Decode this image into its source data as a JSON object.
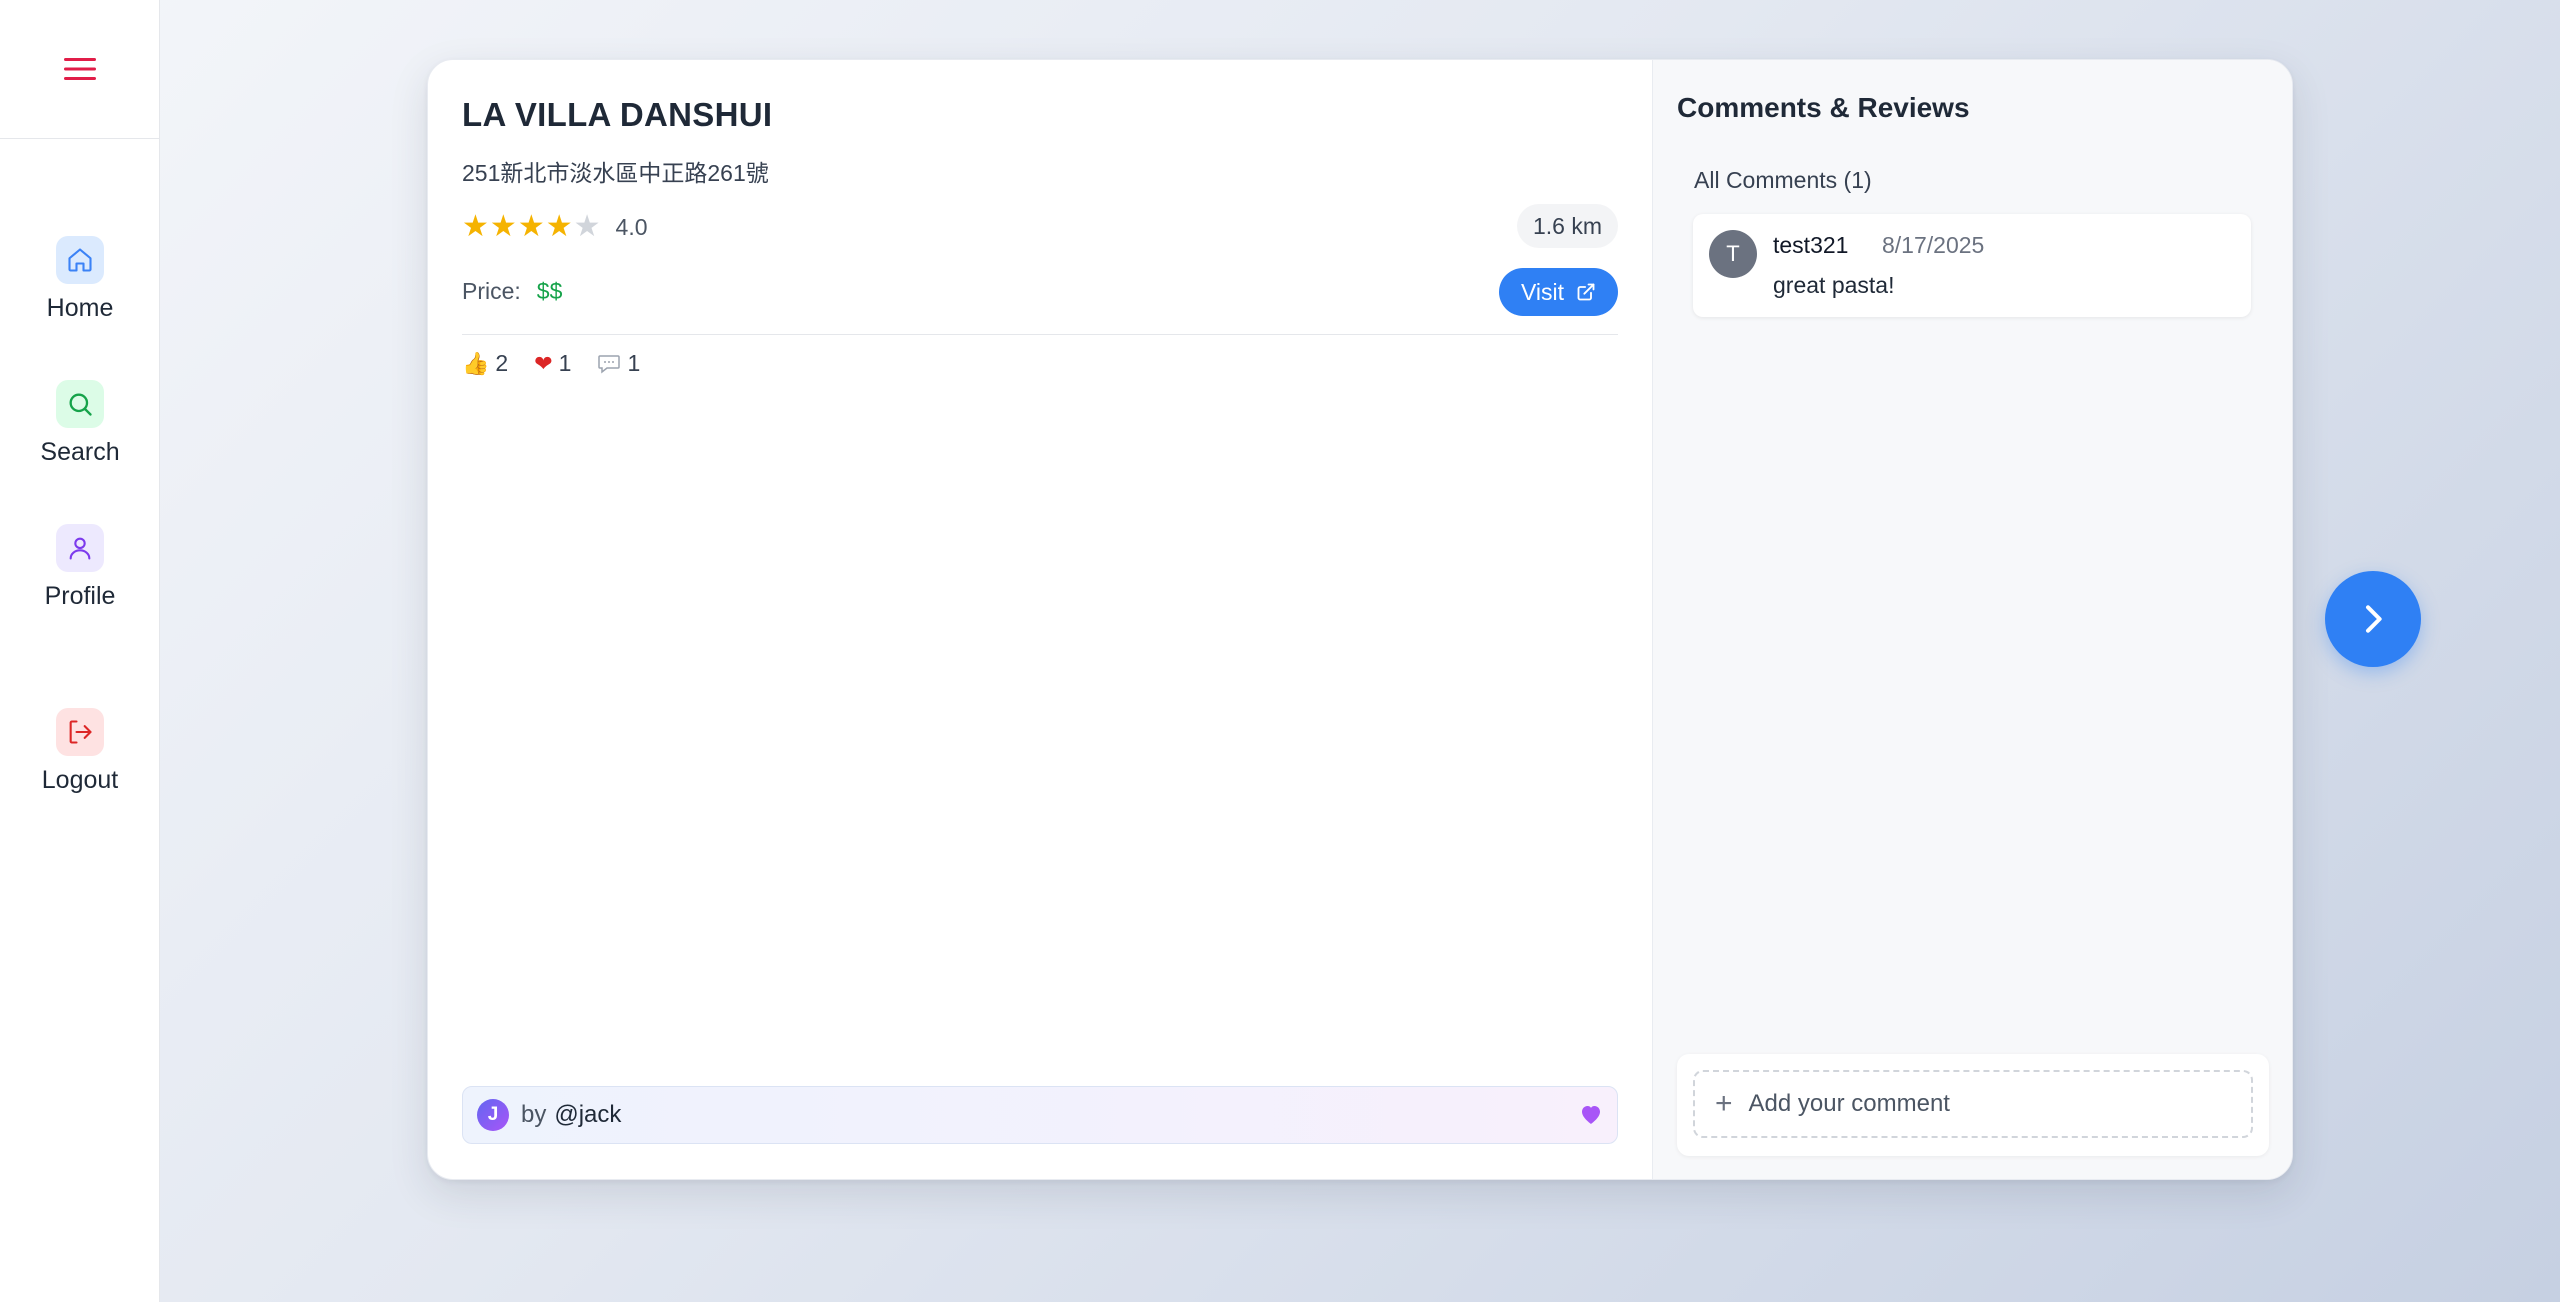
{
  "sidebar": {
    "menu_icon": "hamburger-icon",
    "items": [
      {
        "label": "Home",
        "icon": "home-icon",
        "color": "#3b82f6",
        "bg": "#dbeafe"
      },
      {
        "label": "Search",
        "icon": "search-icon",
        "color": "#16a34a",
        "bg": "#dcfce7"
      },
      {
        "label": "Profile",
        "icon": "user-icon",
        "color": "#7c3aed",
        "bg": "#ede9fe"
      },
      {
        "label": "Logout",
        "icon": "logout-icon",
        "color": "#dc2626",
        "bg": "#fee2e2"
      }
    ]
  },
  "place": {
    "name": "LA VILLA DANSHUI",
    "address": "251新北市淡水區中正路261號",
    "rating": 4.0,
    "rating_text": "4.0",
    "distance": "1.6 km",
    "price_label": "Price:",
    "price": "$$",
    "visit_label": "Visit",
    "reactions": {
      "likes": "2",
      "hearts": "1",
      "comments": "1"
    },
    "author": {
      "initial": "J",
      "by_label": "by",
      "handle": "@jack"
    }
  },
  "comments_panel": {
    "title": "Comments & Reviews",
    "subtitle": "All Comments (1)",
    "comments": [
      {
        "initial": "T",
        "user": "test321",
        "date": "8/17/2025",
        "text": "great pasta!"
      }
    ],
    "add_label": "Add your comment"
  },
  "colors": {
    "accent": "#2f80f4",
    "star": "#f5b301",
    "star_empty": "#d1d5db",
    "price": "#16a34a"
  }
}
